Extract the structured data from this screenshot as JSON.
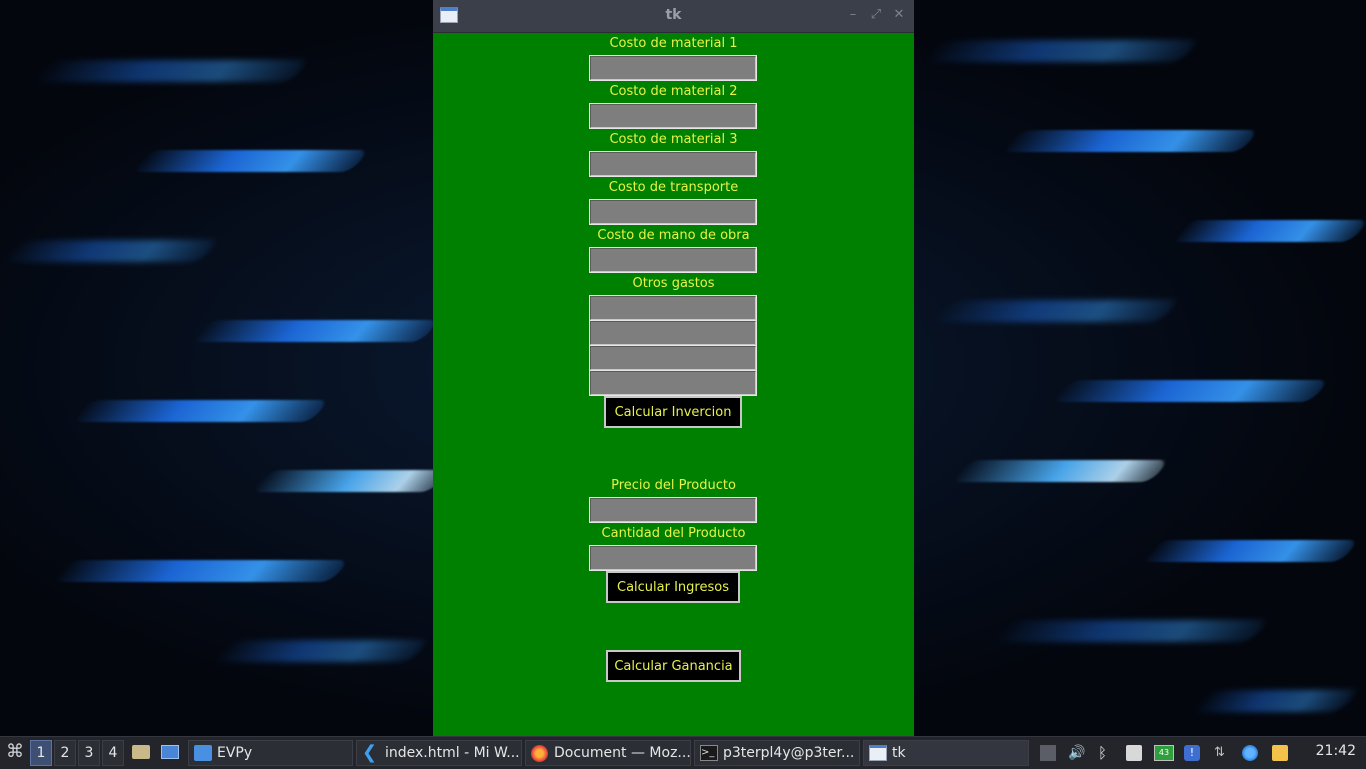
{
  "window": {
    "title": "tk"
  },
  "form": {
    "fields": [
      {
        "label": "Costo de material 1",
        "value": ""
      },
      {
        "label": "Costo de material 2",
        "value": ""
      },
      {
        "label": "Costo de material 3",
        "value": ""
      },
      {
        "label": "Costo de transporte",
        "value": ""
      },
      {
        "label": "Costo de mano de obra",
        "value": ""
      }
    ],
    "otros_gastos": {
      "label": "Otros gastos",
      "values": [
        "",
        "",
        "",
        ""
      ]
    },
    "calcular_invercion_label": "Calcular Invercion",
    "precio": {
      "label": "Precio del Producto",
      "value": ""
    },
    "cantidad": {
      "label": "Cantidad del Producto",
      "value": ""
    },
    "calcular_ingresos_label": "Calcular Ingresos",
    "calcular_ganancia_label": "Calcular Ganancia"
  },
  "taskbar": {
    "workspaces": [
      "1",
      "2",
      "3",
      "4"
    ],
    "active_workspace": "1",
    "tasks": [
      {
        "label": "EVPy",
        "icon": "folder-icon"
      },
      {
        "label": "index.html - Mi W...",
        "icon": "vscode-icon"
      },
      {
        "label": "Document — Moz...",
        "icon": "firefox-icon"
      },
      {
        "label": "p3terpl4y@p3ter...",
        "icon": "terminal-icon"
      },
      {
        "label": "tk",
        "icon": "window-icon"
      }
    ],
    "battery_level": "43",
    "clock": "21:42"
  },
  "colors": {
    "window_bg": "#008000",
    "label_text": "#e8f24a",
    "entry_bg": "#7e7e7e",
    "button_bg": "#000000"
  }
}
